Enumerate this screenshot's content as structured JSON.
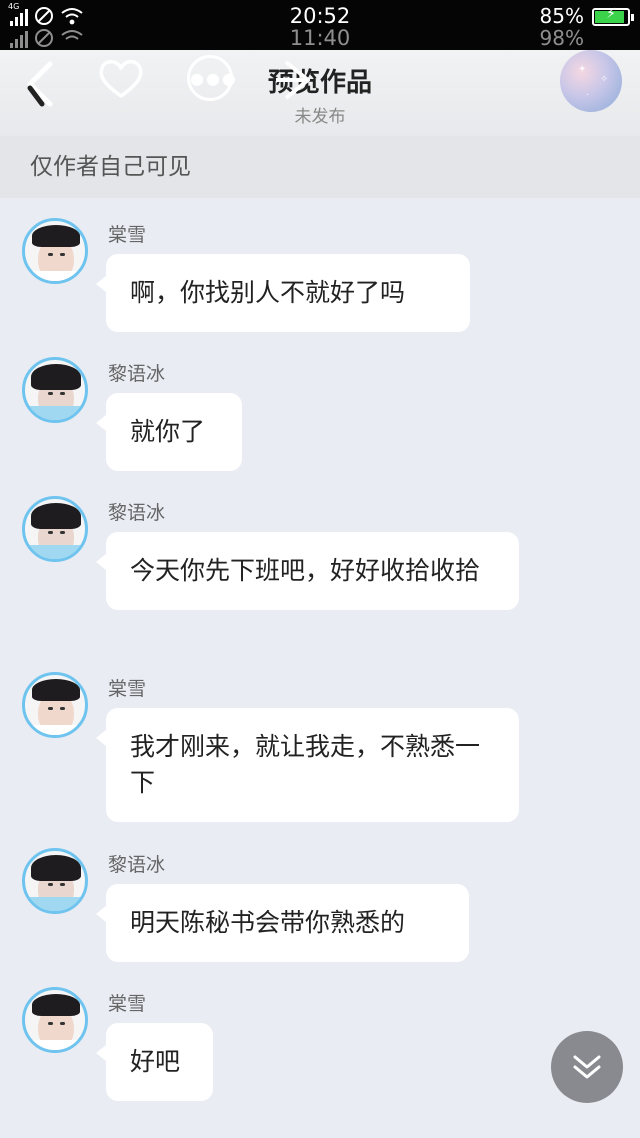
{
  "status_bar": {
    "network": "4G",
    "time": "20:52",
    "battery_percent": "85%",
    "battery_level": 0.85,
    "ghost_time": "11:40",
    "ghost_battery": "98%"
  },
  "nav": {
    "title": "预览作品",
    "subtitle": "未发布",
    "back_icon": "back-chevron-icon",
    "like_icon": "heart-icon",
    "more_icon": "more-dots-icon",
    "share_icon": "share-arrow-icon"
  },
  "notice": "仅作者自己可见",
  "messages": [
    {
      "sender": "棠雪",
      "text": "啊，你找别人不就好了吗"
    },
    {
      "sender": "黎语冰",
      "text": "就你了"
    },
    {
      "sender": "黎语冰",
      "text": "今天你先下班吧，好好收拾收拾"
    },
    {
      "sender": "棠雪",
      "text": "我才刚来，就让我走，不熟悉一下"
    },
    {
      "sender": "黎语冰",
      "text": "明天陈秘书会带你熟悉的"
    },
    {
      "sender": "棠雪",
      "text": "好吧"
    }
  ],
  "scroll_button_icon": "double-chevron-down-icon",
  "colors": {
    "background": "#e9ecf3",
    "avatar_ring": "#6fc4ef",
    "battery": "#3ad34a"
  }
}
